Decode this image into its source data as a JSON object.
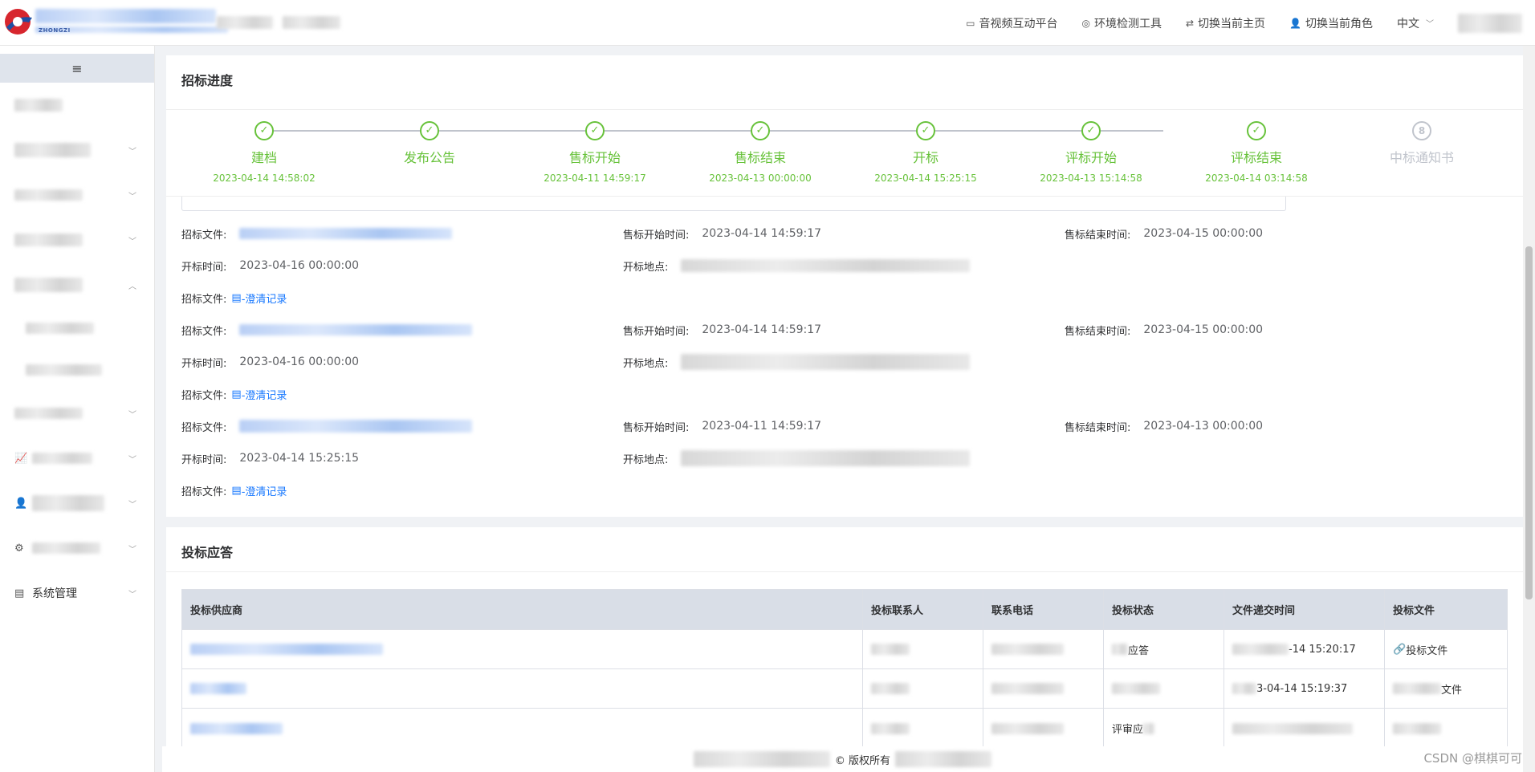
{
  "header": {
    "logo_sub": "ZHONGZI",
    "nav": [
      {
        "label": "音视频互动平台",
        "icon": "video-icon"
      },
      {
        "label": "环境检测工具",
        "icon": "target-icon"
      },
      {
        "label": "切换当前主页",
        "icon": "swap-icon"
      },
      {
        "label": "切换当前角色",
        "icon": "user-icon"
      }
    ],
    "language": "中文"
  },
  "sidebar": {
    "collapse_icon": "≡",
    "last_item": "系统管理"
  },
  "progress": {
    "title": "招标进度",
    "steps": [
      {
        "label": "建档",
        "time": "2023-04-14 14:58:02",
        "status": "done"
      },
      {
        "label": "发布公告",
        "time": "",
        "status": "done"
      },
      {
        "label": "售标开始",
        "time": "2023-04-11 14:59:17",
        "status": "done"
      },
      {
        "label": "售标结束",
        "time": "2023-04-13 00:00:00",
        "status": "done"
      },
      {
        "label": "开标",
        "time": "2023-04-14 15:25:15",
        "status": "done"
      },
      {
        "label": "评标开始",
        "time": "2023-04-13 15:14:58",
        "status": "done"
      },
      {
        "label": "评标结束",
        "time": "2023-04-14 03:14:58",
        "status": "done"
      },
      {
        "label": "中标通知书",
        "time": "",
        "status": "wait",
        "number": "8"
      }
    ]
  },
  "labels": {
    "doc": "招标文件:",
    "sale_start": "售标开始时间:",
    "sale_end": "售标结束时间:",
    "open_time": "开标时间:",
    "open_place": "开标地点:",
    "clarify": "-澄清记录"
  },
  "docs": [
    {
      "sale_start": "2023-04-14 14:59:17",
      "sale_end": "2023-04-15 00:00:00",
      "open_time": "2023-04-16 00:00:00"
    },
    {
      "sale_start": "2023-04-14 14:59:17",
      "sale_end": "2023-04-15 00:00:00",
      "open_time": "2023-04-16 00:00:00"
    },
    {
      "sale_start": "2023-04-11 14:59:17",
      "sale_end": "2023-04-13 00:00:00",
      "open_time": "2023-04-14 15:25:15"
    }
  ],
  "bids": {
    "title": "投标应答",
    "columns": [
      "投标供应商",
      "投标联系人",
      "联系电话",
      "投标状态",
      "文件递交时间",
      "投标文件"
    ],
    "rows": [
      {
        "status": "应答",
        "time": "-14 15:20:17",
        "file": "投标文件"
      },
      {
        "status": "",
        "time": "3-04-14 15:19:37",
        "file": "文件"
      },
      {
        "status": "评审应",
        "time": "",
        "file": ""
      }
    ]
  },
  "footer": {
    "text": "© 版权所有"
  },
  "watermark": "CSDN @棋棋可可"
}
